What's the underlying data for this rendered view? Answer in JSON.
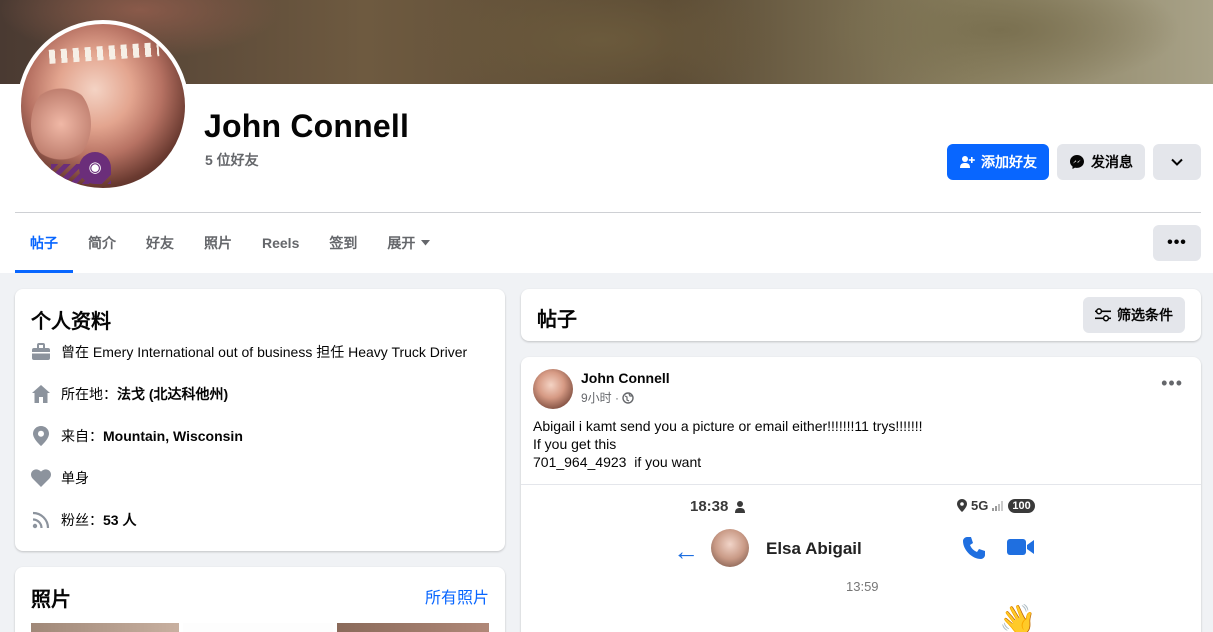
{
  "profile": {
    "name": "John Connell",
    "friends": "5 位好友"
  },
  "actions": {
    "add_friend": "添加好友",
    "message": "发消息"
  },
  "tabs": [
    {
      "label": "帖子",
      "active": true
    },
    {
      "label": "简介"
    },
    {
      "label": "好友"
    },
    {
      "label": "照片"
    },
    {
      "label": "Reels"
    },
    {
      "label": "签到"
    },
    {
      "label": "展开"
    }
  ],
  "intro": {
    "title": "个人资料",
    "work_prefix": "曾在 Emery International out of business 担任 Heavy Truck Driver",
    "location_label": "所在地：",
    "location_value": "法戈 (北达科他州)",
    "from_label": "来自：",
    "from_value": "Mountain, Wisconsin",
    "relationship": "单身",
    "followers_label": "粉丝：",
    "followers_value": "53 人"
  },
  "photos": {
    "title": "照片",
    "see_all": "所有照片"
  },
  "posts": {
    "title": "帖子",
    "filter": "筛选条件"
  },
  "post": {
    "author": "John Connell",
    "time": "9小时 ·",
    "lines": [
      "Abigail i kamt send you a picture or email either!!!!!!!11 trys!!!!!!!",
      "If you get this",
      "701_964_4923  if you want"
    ],
    "screenshot": {
      "status_time": "18:38",
      "network": "5G",
      "battery": "100",
      "contact": "Elsa Abigail",
      "chat_time": "13:59"
    }
  },
  "colors": {
    "accent": "#0866ff",
    "page_bg": "#f0f2f5"
  }
}
